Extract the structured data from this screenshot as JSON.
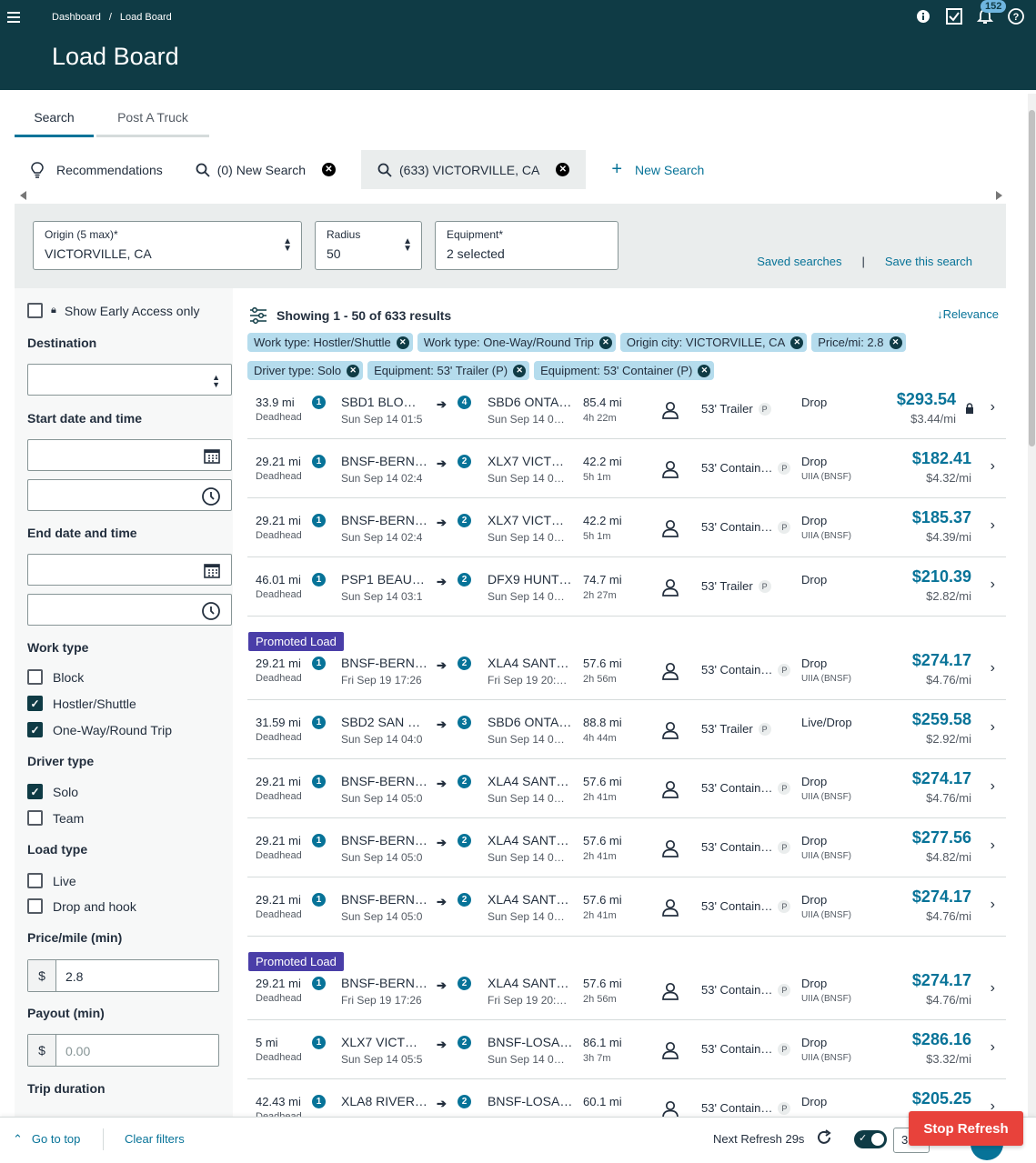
{
  "header": {
    "breadcrumb": [
      "Dashboard",
      "Load Board"
    ],
    "breadcrumb_sep": "/",
    "title": "Load Board",
    "notification_count": "152"
  },
  "tabs": [
    "Search",
    "Post A Truck"
  ],
  "searches": [
    {
      "label": "Recommendations",
      "icon": "bulb-icon"
    },
    {
      "label": "(0) New Search",
      "icon": "search-icon"
    },
    {
      "label": "(633) VICTORVILLE, CA",
      "icon": "search-icon"
    }
  ],
  "new_search_label": "New Search",
  "criteria": {
    "origin_label": "Origin (5 max)*",
    "origin_value": "VICTORVILLE, CA",
    "radius_label": "Radius",
    "radius_value": "50",
    "equipment_label": "Equipment*",
    "equipment_value": "2 selected",
    "saved_searches": "Saved searches",
    "sep": "|",
    "save_this": "Save this search"
  },
  "filters": {
    "early_access": "Show Early Access only",
    "destination": "Destination",
    "start_date": "Start date and time",
    "end_date": "End date and time",
    "work_type": "Work type",
    "work_type_options": [
      "Block",
      "Hostler/Shuttle",
      "One-Way/Round Trip"
    ],
    "driver_type": "Driver type",
    "driver_type_options": [
      "Solo",
      "Team"
    ],
    "load_type": "Load type",
    "load_type_options": [
      "Live",
      "Drop and hook"
    ],
    "price_mile": "Price/mile (min)",
    "currency": "$",
    "price_mile_value": "2.8",
    "payout": "Payout (min)",
    "payout_placeholder": "0.00",
    "trip_duration": "Trip duration"
  },
  "results": {
    "showing": "Showing 1 - 50 of 633 results",
    "sort": "Relevance",
    "pills": [
      "Work type: Hostler/Shuttle",
      "Work type: One-Way/Round Trip",
      "Origin city: VICTORVILLE, CA",
      "Price/mi: 2.8",
      "Driver type: Solo",
      "Equipment: 53' Trailer (P)",
      "Equipment: 53' Container (P)"
    ],
    "deadhead_label": "Deadhead",
    "promoted_label": "Promoted Load",
    "rows": [
      {
        "dh": "33.9 mi",
        "n1": "1",
        "from": "SBD1 BLO…",
        "from_dt": "Sun Sep 14 01:5",
        "n2": "4",
        "to": "SBD6 ONTA…",
        "to_dt": "Sun Sep 14 0…",
        "mi": "85.4 mi",
        "tm": "4h 22m",
        "equip": "53' Trailer",
        "type": "Drop",
        "sub": "",
        "price": "$293.54",
        "ppm": "$3.44/mi",
        "promoted": false,
        "lock": true
      },
      {
        "dh": "29.21 mi",
        "n1": "1",
        "from": "BNSF-BERN…",
        "from_dt": "Sun Sep 14 02:4",
        "n2": "2",
        "to": "XLX7 VICT…",
        "to_dt": "Sun Sep 14 0…",
        "mi": "42.2 mi",
        "tm": "5h 1m",
        "equip": "53' Contain…",
        "type": "Drop",
        "sub": "UIIA (BNSF)",
        "price": "$182.41",
        "ppm": "$4.32/mi",
        "promoted": false
      },
      {
        "dh": "29.21 mi",
        "n1": "1",
        "from": "BNSF-BERN…",
        "from_dt": "Sun Sep 14 02:4",
        "n2": "2",
        "to": "XLX7 VICT…",
        "to_dt": "Sun Sep 14 0…",
        "mi": "42.2 mi",
        "tm": "5h 1m",
        "equip": "53' Contain…",
        "type": "Drop",
        "sub": "UIIA (BNSF)",
        "price": "$185.37",
        "ppm": "$4.39/mi",
        "promoted": false
      },
      {
        "dh": "46.01 mi",
        "n1": "1",
        "from": "PSP1 BEAU…",
        "from_dt": "Sun Sep 14 03:1",
        "n2": "2",
        "to": "DFX9 HUNT…",
        "to_dt": "Sun Sep 14 0…",
        "mi": "74.7 mi",
        "tm": "2h 27m",
        "equip": "53' Trailer",
        "type": "Drop",
        "sub": "",
        "price": "$210.39",
        "ppm": "$2.82/mi",
        "promoted": false
      },
      {
        "dh": "29.21 mi",
        "n1": "1",
        "from": "BNSF-BERN…",
        "from_dt": "Fri Sep 19 17:26",
        "n2": "2",
        "to": "XLA4 SANT…",
        "to_dt": "Fri Sep 19 20:…",
        "mi": "57.6 mi",
        "tm": "2h 56m",
        "equip": "53' Contain…",
        "type": "Drop",
        "sub": "UIIA (BNSF)",
        "price": "$274.17",
        "ppm": "$4.76/mi",
        "promoted": true
      },
      {
        "dh": "31.59 mi",
        "n1": "1",
        "from": "SBD2 SAN …",
        "from_dt": "Sun Sep 14 04:0",
        "n2": "3",
        "to": "SBD6 ONTA…",
        "to_dt": "Sun Sep 14 0…",
        "mi": "88.8 mi",
        "tm": "4h 44m",
        "equip": "53' Trailer",
        "type": "Live/Drop",
        "sub": "",
        "price": "$259.58",
        "ppm": "$2.92/mi",
        "promoted": false
      },
      {
        "dh": "29.21 mi",
        "n1": "1",
        "from": "BNSF-BERN…",
        "from_dt": "Sun Sep 14 05:0",
        "n2": "2",
        "to": "XLA4 SANT…",
        "to_dt": "Sun Sep 14 0…",
        "mi": "57.6 mi",
        "tm": "2h 41m",
        "equip": "53' Contain…",
        "type": "Drop",
        "sub": "UIIA (BNSF)",
        "price": "$274.17",
        "ppm": "$4.76/mi",
        "promoted": false
      },
      {
        "dh": "29.21 mi",
        "n1": "1",
        "from": "BNSF-BERN…",
        "from_dt": "Sun Sep 14 05:0",
        "n2": "2",
        "to": "XLA4 SANT…",
        "to_dt": "Sun Sep 14 0…",
        "mi": "57.6 mi",
        "tm": "2h 41m",
        "equip": "53' Contain…",
        "type": "Drop",
        "sub": "UIIA (BNSF)",
        "price": "$277.56",
        "ppm": "$4.82/mi",
        "promoted": false
      },
      {
        "dh": "29.21 mi",
        "n1": "1",
        "from": "BNSF-BERN…",
        "from_dt": "Sun Sep 14 05:0",
        "n2": "2",
        "to": "XLA4 SANT…",
        "to_dt": "Sun Sep 14 0…",
        "mi": "57.6 mi",
        "tm": "2h 41m",
        "equip": "53' Contain…",
        "type": "Drop",
        "sub": "UIIA (BNSF)",
        "price": "$274.17",
        "ppm": "$4.76/mi",
        "promoted": false
      },
      {
        "dh": "29.21 mi",
        "n1": "1",
        "from": "BNSF-BERN…",
        "from_dt": "Fri Sep 19 17:26",
        "n2": "2",
        "to": "XLA4 SANT…",
        "to_dt": "Fri Sep 19 20:…",
        "mi": "57.6 mi",
        "tm": "2h 56m",
        "equip": "53' Contain…",
        "type": "Drop",
        "sub": "UIIA (BNSF)",
        "price": "$274.17",
        "ppm": "$4.76/mi",
        "promoted": true
      },
      {
        "dh": "5 mi",
        "n1": "1",
        "from": "XLX7 VICT…",
        "from_dt": "Sun Sep 14 05:5",
        "n2": "2",
        "to": "BNSF-LOSA…",
        "to_dt": "Sun Sep 14 0…",
        "mi": "86.1 mi",
        "tm": "3h 7m",
        "equip": "53' Contain…",
        "type": "Drop",
        "sub": "UIIA (BNSF)",
        "price": "$286.16",
        "ppm": "$3.32/mi",
        "promoted": false
      },
      {
        "dh": "42.43 mi",
        "n1": "1",
        "from": "XLA8 RIVER…",
        "from_dt": "",
        "n2": "2",
        "to": "BNSF-LOSA…",
        "to_dt": "",
        "mi": "60.1 mi",
        "tm": "",
        "equip": "53' Contain…",
        "type": "Drop",
        "sub": "",
        "price": "$205.25",
        "ppm": "",
        "promoted": false
      }
    ]
  },
  "footer": {
    "goto_top": "Go to top",
    "clear_filters": "Clear filters",
    "next_refresh": "Next Refresh 29s",
    "box_value": "3",
    "stop_refresh": "Stop Refresh"
  },
  "colors": {
    "header_bg": "#0f3b45",
    "accent": "#077398",
    "promoted": "#4a3ea8",
    "stop_refresh": "#e8423b"
  }
}
